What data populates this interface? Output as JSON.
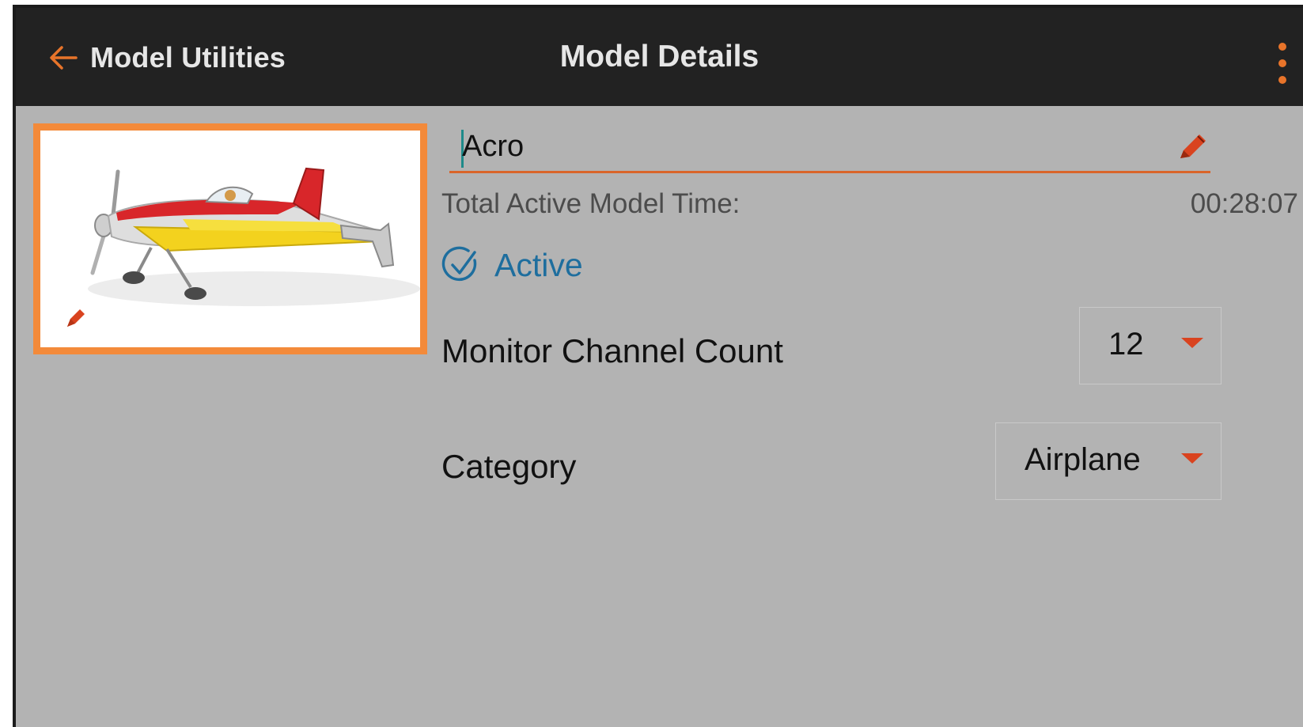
{
  "header": {
    "back_label": "Model Utilities",
    "title": "Model Details",
    "back_icon": "arrow-left-icon",
    "menu_icon": "more-vertical-icon"
  },
  "model": {
    "image_alt": "Model image",
    "name_value": "Acro",
    "total_time_label": "Total Active Model Time:",
    "total_time_value": "00:28:07",
    "active_label": "Active"
  },
  "settings": {
    "monitor_channel_label": "Monitor Channel Count",
    "monitor_channel_value": "12",
    "category_label": "Category",
    "category_value": "Airplane"
  },
  "colors": {
    "accent": "#e8742a",
    "highlight_border": "#f38a3a",
    "active_blue": "#1e6e9e",
    "topbar": "#222222",
    "background": "#b3b3b3"
  }
}
